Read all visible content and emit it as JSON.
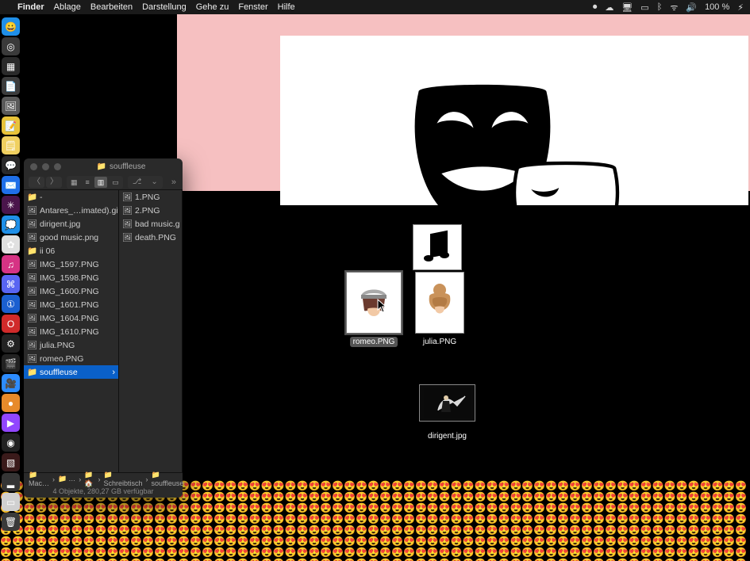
{
  "menubar": {
    "app": "Finder",
    "items": [
      "Ablage",
      "Bearbeiten",
      "Darstellung",
      "Gehe zu",
      "Fenster",
      "Hilfe"
    ],
    "battery_pct": "100 %",
    "battery_icon": "⚡︎"
  },
  "dock": {
    "items": [
      {
        "name": "finder",
        "color": "#1f8fe8",
        "glyph": "😀"
      },
      {
        "name": "safari",
        "color": "#3a3a3a",
        "glyph": "◎"
      },
      {
        "name": "app3",
        "color": "#2a2a2a",
        "glyph": "▦"
      },
      {
        "name": "pages",
        "color": "#3c3c3c",
        "glyph": "📄"
      },
      {
        "name": "preview",
        "color": "#5a5a5a",
        "glyph": "🖼"
      },
      {
        "name": "notes",
        "color": "#e8c33a",
        "glyph": "📝"
      },
      {
        "name": "stickies",
        "color": "#f0d060",
        "glyph": "🗒"
      },
      {
        "name": "messages",
        "color": "#2a2a2a",
        "glyph": "💬"
      },
      {
        "name": "mail",
        "color": "#1f6fe8",
        "glyph": "✉️"
      },
      {
        "name": "slack",
        "color": "#4a154b",
        "glyph": "✳︎"
      },
      {
        "name": "chat",
        "color": "#1f8fe8",
        "glyph": "💭"
      },
      {
        "name": "photos",
        "color": "#e0e0e0",
        "glyph": "✿"
      },
      {
        "name": "itunes",
        "color": "#d63384",
        "glyph": "♫"
      },
      {
        "name": "discord",
        "color": "#5865F2",
        "glyph": "⌘"
      },
      {
        "name": "1password",
        "color": "#1a5fd0",
        "glyph": "①"
      },
      {
        "name": "opera",
        "color": "#d02a2a",
        "glyph": "O"
      },
      {
        "name": "audio",
        "color": "#222",
        "glyph": "⚙︎"
      },
      {
        "name": "video",
        "color": "#222",
        "glyph": "🎬"
      },
      {
        "name": "zoom",
        "color": "#2d8cff",
        "glyph": "🎥"
      },
      {
        "name": "capture",
        "color": "#e78a2a",
        "glyph": "●"
      },
      {
        "name": "twitch",
        "color": "#9146FF",
        "glyph": "▶"
      },
      {
        "name": "obs",
        "color": "#222",
        "glyph": "◉"
      },
      {
        "name": "pattern",
        "color": "#3a1a1a",
        "glyph": "▧"
      },
      {
        "name": "app24",
        "color": "#353535",
        "glyph": "▂"
      },
      {
        "name": "app25",
        "color": "#d0d0d0",
        "glyph": "▭"
      },
      {
        "name": "trash",
        "color": "#3a3a3a",
        "glyph": "🗑"
      }
    ]
  },
  "finder": {
    "title": "souffleuse",
    "columns": [
      {
        "rows": [
          {
            "icon": "📁",
            "label": "-",
            "type": "folder"
          },
          {
            "icon": "🖼",
            "label": "Antares_…imated).gif",
            "type": "file"
          },
          {
            "icon": "🖼",
            "label": "dirigent.jpg",
            "type": "file"
          },
          {
            "icon": "🖼",
            "label": "good music.png",
            "type": "file"
          },
          {
            "icon": "📁",
            "label": "ii 06",
            "type": "folder"
          },
          {
            "icon": "🖼",
            "label": "IMG_1597.PNG",
            "type": "file"
          },
          {
            "icon": "🖼",
            "label": "IMG_1598.PNG",
            "type": "file"
          },
          {
            "icon": "🖼",
            "label": "IMG_1600.PNG",
            "type": "file"
          },
          {
            "icon": "🖼",
            "label": "IMG_1601.PNG",
            "type": "file"
          },
          {
            "icon": "🖼",
            "label": "IMG_1604.PNG",
            "type": "file"
          },
          {
            "icon": "🖼",
            "label": "IMG_1610.PNG",
            "type": "file"
          },
          {
            "icon": "🖼",
            "label": "julia.PNG",
            "type": "file"
          },
          {
            "icon": "🖼",
            "label": "romeo.PNG",
            "type": "file"
          },
          {
            "icon": "📁",
            "label": "souffleuse",
            "type": "folder",
            "selected": true
          }
        ]
      },
      {
        "rows": [
          {
            "icon": "🖼",
            "label": "1.PNG",
            "type": "file"
          },
          {
            "icon": "🖼",
            "label": "2.PNG",
            "type": "file"
          },
          {
            "icon": "🖼",
            "label": "bad music.g",
            "type": "file"
          },
          {
            "icon": "🖼",
            "label": "death.PNG",
            "type": "file"
          }
        ]
      }
    ],
    "path": [
      "Mac…",
      "…",
      "🏠",
      "Schreibtisch",
      "souffleuse"
    ],
    "status": "4 Objekte, 280,27 GB verfügbar"
  },
  "stage": {
    "items": [
      {
        "name": "music-note",
        "label": ""
      },
      {
        "name": "romeo",
        "label": "romeo.PNG",
        "selected": true
      },
      {
        "name": "julia",
        "label": "julia.PNG"
      },
      {
        "name": "dirigent",
        "label": "dirigent.jpg"
      }
    ]
  },
  "emoji_row": "😍😍😍😍😍😍😍😍😍😍😍😍😍😍😍😍😍😍😍😍😍😍😍😍😍😍😍😍😍😍😍😍😍😍😍😍😍😍😍😍😍😍😍😍😍😍😍😍😍😍😍😍😍😍😍😍😍😍😍😍😍😍😍😍😍😍😍😍😍😍😍😍😍"
}
